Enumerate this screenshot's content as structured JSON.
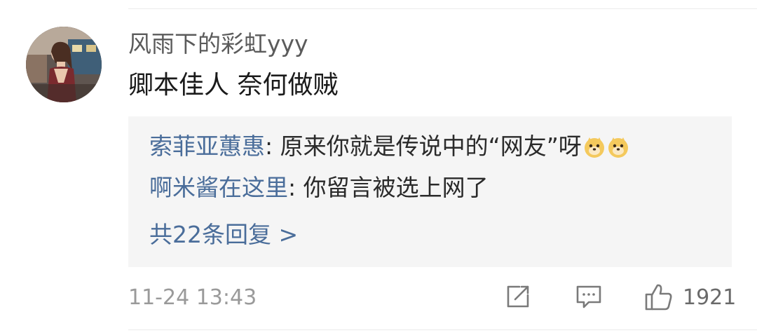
{
  "comment": {
    "username": "风雨下的彩虹yyy",
    "text": "卿本佳人 奈何做贼",
    "timestamp": "11-24 13:43",
    "like_count": "1921"
  },
  "replies": [
    {
      "name": "索菲亚蕙惠",
      "separator": ": ",
      "text": "原来你就是传说中的“网友”呀",
      "emojis": [
        "doge-emoji",
        "doge-emoji"
      ]
    },
    {
      "name": "啊米酱在这里",
      "separator": ": ",
      "text": "你留言被选上网了",
      "emojis": []
    }
  ],
  "more_replies_label": "共22条回复 >",
  "icons": {
    "share": "share-icon",
    "comment": "comment-icon",
    "like": "thumbs-up-icon"
  },
  "colors": {
    "link_blue": "#4a6d9a",
    "reply_bg": "#f5f5f5",
    "username_gray": "#5b5b5b",
    "meta_gray": "#9a9a9a"
  }
}
